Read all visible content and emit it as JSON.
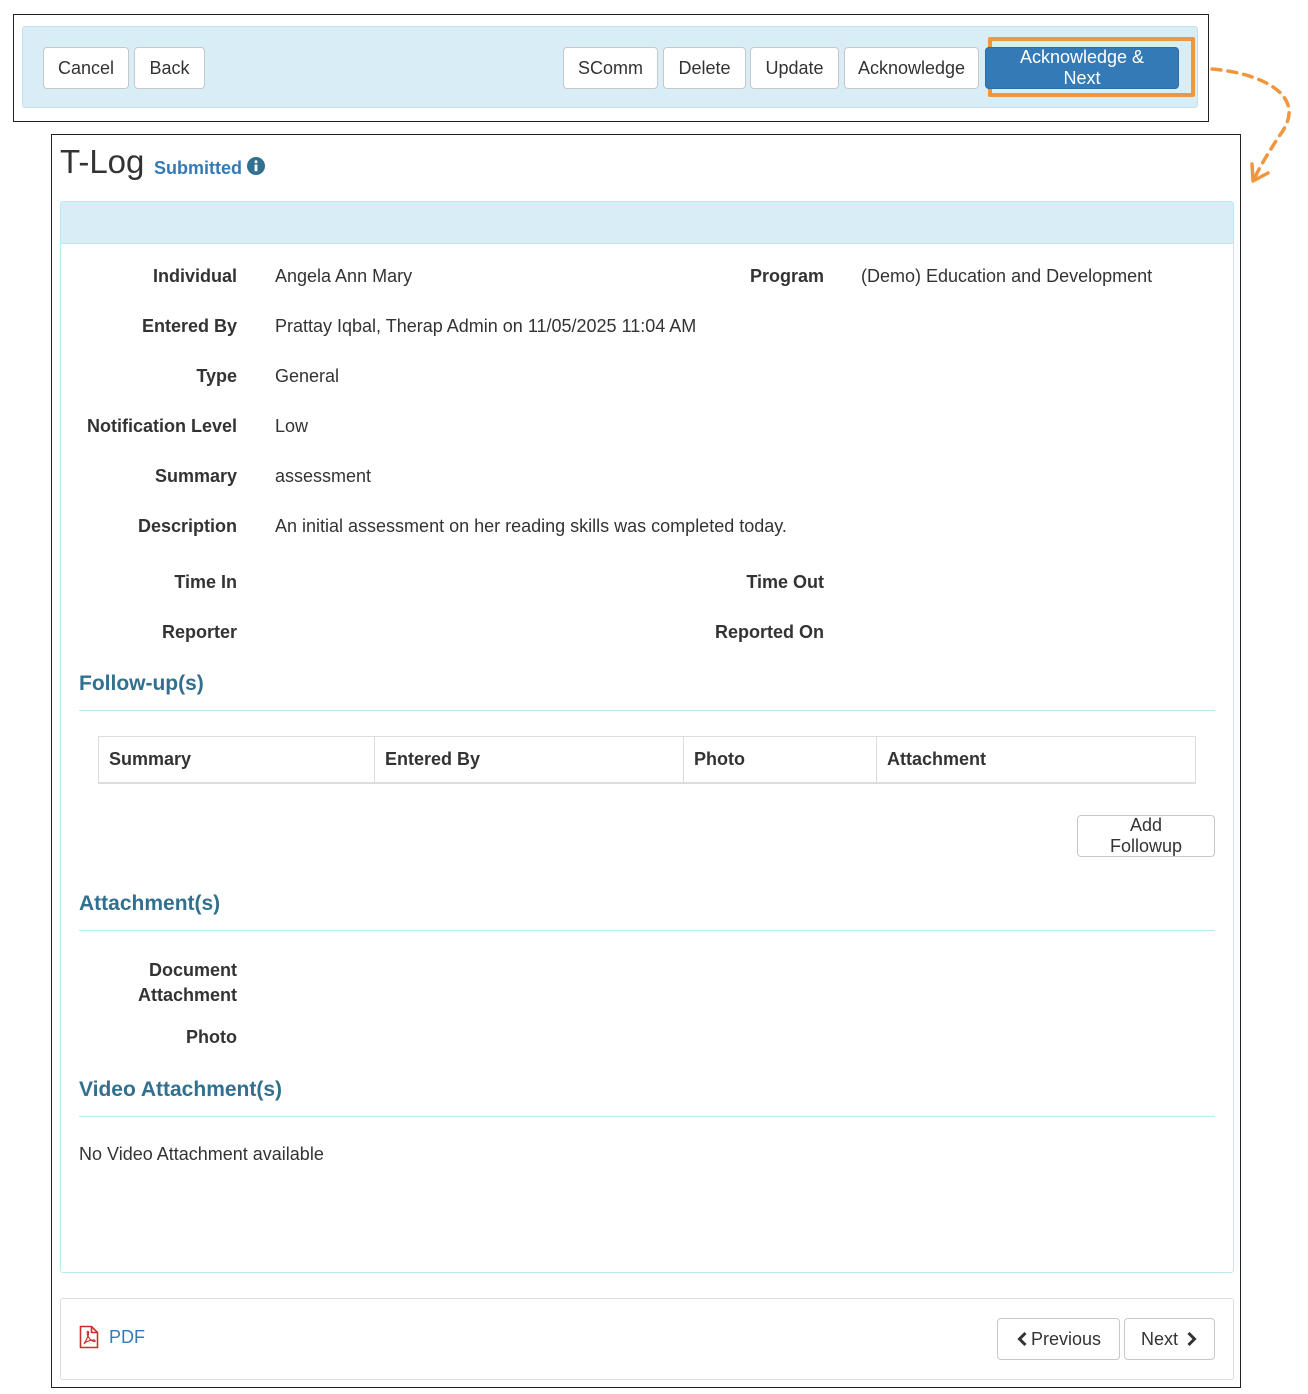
{
  "toolbar": {
    "cancel_label": "Cancel",
    "back_label": "Back",
    "scomm_label": "SComm",
    "delete_label": "Delete",
    "update_label": "Update",
    "acknowledge_label": "Acknowledge",
    "acknowledge_next_label": "Acknowledge & Next"
  },
  "header": {
    "title": "T-Log",
    "status": "Submitted",
    "status_icon": "info-circle-icon"
  },
  "details": {
    "individual_label": "Individual",
    "individual_value": "Angela Ann Mary",
    "program_label": "Program",
    "program_value": "(Demo) Education and Development",
    "entered_by_label": "Entered By",
    "entered_by_value": "Prattay Iqbal, Therap Admin on 11/05/2025 11:04 AM",
    "type_label": "Type",
    "type_value": "General",
    "notification_label": "Notification Level",
    "notification_value": "Low",
    "summary_label": "Summary",
    "summary_value": "assessment",
    "description_label": "Description",
    "description_value": "An initial assessment on her reading skills was completed today.",
    "time_in_label": "Time In",
    "time_out_label": "Time Out",
    "reporter_label": "Reporter",
    "reported_on_label": "Reported On"
  },
  "followups": {
    "title": "Follow-up(s)",
    "columns": [
      "Summary",
      "Entered By",
      "Photo",
      "Attachment"
    ],
    "add_label": "Add Followup"
  },
  "attachments": {
    "title": "Attachment(s)",
    "document_label_line1": "Document",
    "document_label_line2": "Attachment",
    "photo_label": "Photo"
  },
  "videos": {
    "title": "Video Attachment(s)",
    "empty_text": "No Video Attachment available"
  },
  "footer": {
    "pdf_label": "PDF",
    "previous_label": "Previous",
    "next_label": "Next"
  },
  "colors": {
    "primary": "#337ab7",
    "panel_heading": "#d9edf7",
    "section_title": "#31708f",
    "highlight": "#f0963c"
  }
}
